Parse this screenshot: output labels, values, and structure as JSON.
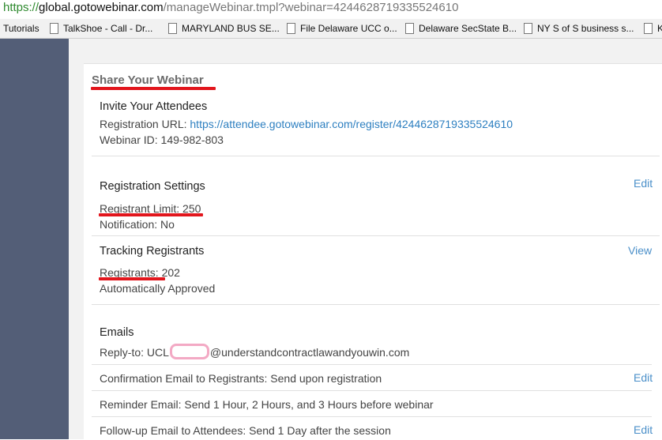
{
  "browser": {
    "url_scheme": "https://",
    "url_host": "global.gotowebinar.com",
    "url_path": "/manageWebinar.tmpl?webinar=4244628719335524610"
  },
  "bookmarks": [
    {
      "label": "Tutorials"
    },
    {
      "label": "TalkShoe - Call - Dr..."
    },
    {
      "label": "MARYLAND BUS SE..."
    },
    {
      "label": "File Delaware UCC o..."
    },
    {
      "label": "Delaware SecState B..."
    },
    {
      "label": "NY S of S business s..."
    },
    {
      "label": "K"
    }
  ],
  "page": {
    "title": "Share Your Webinar"
  },
  "invite": {
    "heading": "Invite Your Attendees",
    "reg_url_label": "Registration URL:",
    "reg_url": "https://attendee.gotowebinar.com/register/4244628719335524610",
    "webinar_id": "Webinar ID: 149-982-803"
  },
  "registration_settings": {
    "heading": "Registration Settings",
    "edit_label": "Edit",
    "limit": "Registrant Limit: 250",
    "notification": "Notification: No"
  },
  "tracking": {
    "heading": "Tracking Registrants",
    "view_label": "View",
    "registrants": "Registrants: 202",
    "approval": "Automatically Approved"
  },
  "emails": {
    "heading": "Emails",
    "reply_to_prefix": "Reply-to: UCL",
    "reply_to_suffix": "@understandcontractlawandyouwin.com",
    "confirmation": "Confirmation Email to Registrants: Send upon registration",
    "confirmation_edit": "Edit",
    "reminder": "Reminder Email: Send 1 Hour, 2 Hours, and 3 Hours before webinar",
    "followup": "Follow-up Email to Attendees: Send 1 Day after the session",
    "followup_edit": "Edit"
  },
  "colors": {
    "rail": "#535e77",
    "link": "#2d7fc0",
    "annotation_red": "#e2161d",
    "redaction_pink": "#f3a9c4"
  }
}
